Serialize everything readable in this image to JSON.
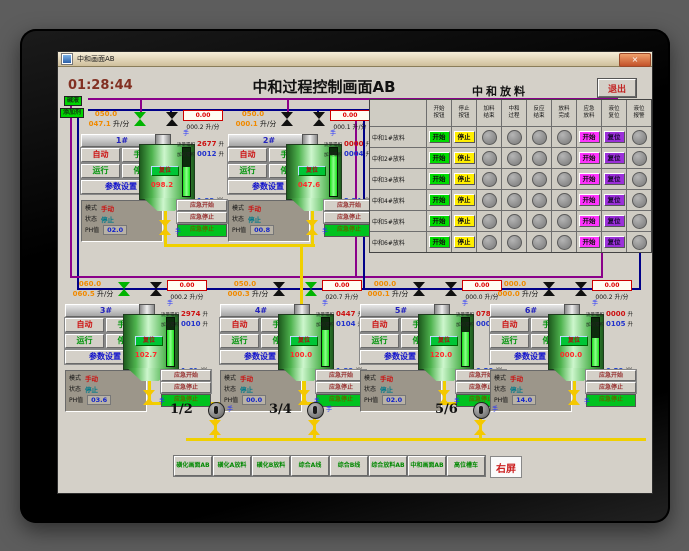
{
  "window": {
    "title": "中和画面AB",
    "close_glyph": "×"
  },
  "header": {
    "time": "01:28:44",
    "title": "中和过程控制画面AB",
    "table_title": "中和放料",
    "exit": "退出"
  },
  "supply_labels": [
    "碱液",
    "添加剂"
  ],
  "unit_labels": {
    "auto": "自动",
    "man": "手动",
    "run": "运行",
    "stop": "停止",
    "params": "参数设置",
    "mode": "模式",
    "mode_val": "手动",
    "state": "状态",
    "state_val": "停止",
    "ph": "PH值",
    "total1": "流量累积",
    "total2": "加料累积",
    "liters": "升",
    "reset": "复位",
    "meters": "米",
    "flow_unit": "升/分",
    "e1": "应急开始",
    "e2": "应急停止",
    "e3": "应急停止",
    "hand": "手"
  },
  "units": [
    {
      "id": "1#",
      "sp": "050.0",
      "flow": "047.1",
      "aux": "0.00",
      "aflow": "000.2",
      "vl": "green",
      "vr": "black",
      "ph": "02.0",
      "t1": "2677",
      "t2": "0012",
      "tval": "098.2",
      "lvl": "1.33",
      "lvl_pct": 60
    },
    {
      "id": "2#",
      "sp": "050.0",
      "flow": "000.1",
      "aux": "0.00",
      "aflow": "000.1",
      "vl": "black",
      "vr": "black",
      "ph": "00.8",
      "t1": "0000",
      "t2": "0004",
      "tval": "047.6",
      "lvl": "3.34",
      "lvl_pct": 85
    },
    {
      "id": "3#",
      "sp": "060.0",
      "flow": "060.5",
      "aux": "0.00",
      "aflow": "000.2",
      "vl": "green",
      "vr": "black",
      "ph": "03.6",
      "t1": "2974",
      "t2": "0010",
      "tval": "102.7",
      "lvl": "1.61",
      "lvl_pct": 75
    },
    {
      "id": "4#",
      "sp": "050.0",
      "flow": "000.3",
      "aux": "0.00",
      "aflow": "020.7",
      "vl": "black",
      "vr": "green",
      "ph": "00.0",
      "t1": "0447",
      "t2": "0104",
      "tval": "100.0",
      "lvl": "1.29",
      "lvl_pct": 75
    },
    {
      "id": "5#",
      "sp": "000.0",
      "flow": "000.1",
      "aux": "0.00",
      "aflow": "000.0",
      "vl": "black",
      "vr": "black",
      "ph": "02.0",
      "t1": "0787",
      "t2": "0001",
      "tval": "120.0",
      "lvl": "0.50",
      "lvl_pct": 70
    },
    {
      "id": "6#",
      "sp": "000.0",
      "flow": "000.0",
      "aux": "0.00",
      "aflow": "000.2",
      "vl": "black",
      "vr": "black",
      "ph": "14.0",
      "t1": "0000",
      "t2": "0105",
      "tval": "000.0",
      "lvl": "0.50",
      "lvl_pct": 58
    }
  ],
  "table": {
    "headers": [
      "开始\n按钮",
      "停止\n按钮",
      "加料\n结束",
      "中和\n过程",
      "反应\n结束",
      "放料\n完成",
      "应急\n放料",
      "液位\n复位",
      "液位\n报警"
    ],
    "row_buttons": {
      "start": "开始",
      "stop": "停止",
      "estart": "开始",
      "reset": "复位"
    },
    "rows": [
      {
        "label": "中和1#放料"
      },
      {
        "label": "中和2#放料"
      },
      {
        "label": "中和3#放料"
      },
      {
        "label": "中和4#放料"
      },
      {
        "label": "中和5#放料"
      },
      {
        "label": "中和6#放料"
      }
    ]
  },
  "pumps": [
    {
      "label": "1/2"
    },
    {
      "label": "3/4"
    },
    {
      "label": "5/6"
    }
  ],
  "bottom_buttons": [
    "磺化画面AB",
    "磺化A放料",
    "磺化B放料",
    "综合A线",
    "综合B线",
    "综合放料AB",
    "中和画面AB",
    "高位槽车"
  ],
  "right_button": "右屏",
  "colors": {
    "start_green": "#00dd00",
    "stop_yellow": "#ffee00",
    "emergency_magenta": "#ff33ff",
    "reset_purple": "#9b30d9",
    "pipe_purple": "#8a008a",
    "pipe_navy": "#000088",
    "pipe_yellow": "#f0d000",
    "tank_green": "#4eb34e"
  }
}
